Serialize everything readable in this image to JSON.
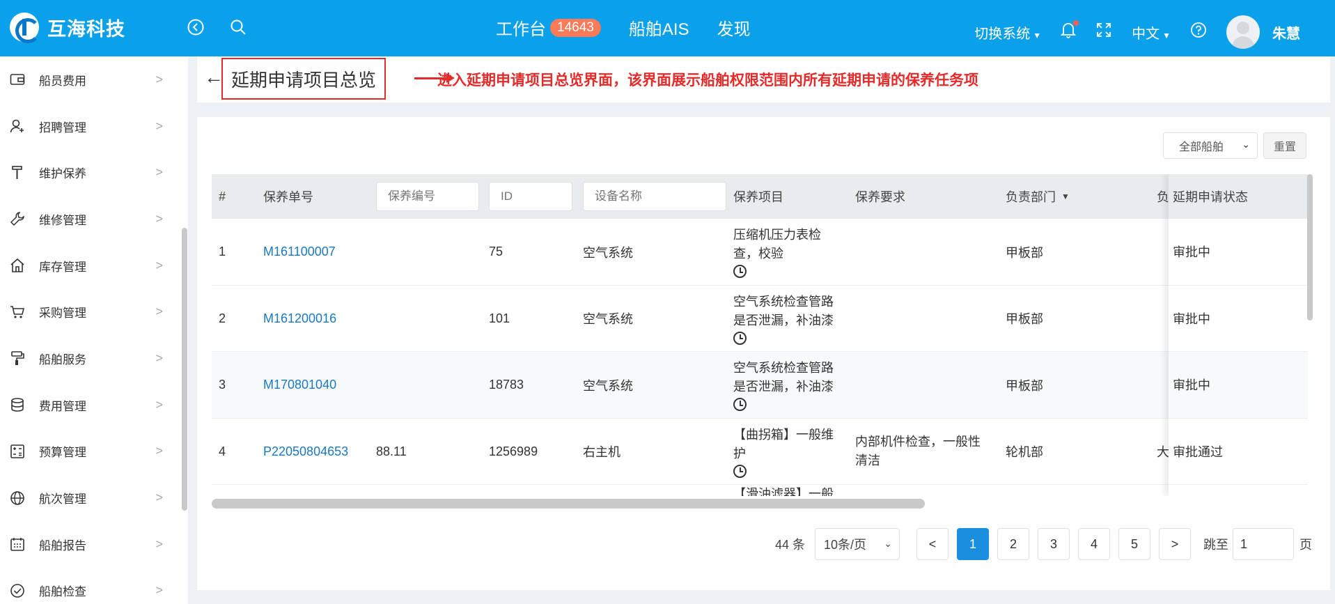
{
  "header": {
    "logo_text": "互海科技",
    "nav": [
      {
        "label": "工作台",
        "badge": "14643"
      },
      {
        "label": "船舶AIS"
      },
      {
        "label": "发现"
      }
    ],
    "switch_system": "切换系统",
    "language": "中文",
    "username": "朱慧"
  },
  "sidebar": {
    "items": [
      {
        "label": "船员费用",
        "icon": "wallet-icon"
      },
      {
        "label": "招聘管理",
        "icon": "user-add-icon"
      },
      {
        "label": "维护保养",
        "icon": "brush-icon"
      },
      {
        "label": "维修管理",
        "icon": "wrench-icon"
      },
      {
        "label": "库存管理",
        "icon": "home-icon"
      },
      {
        "label": "采购管理",
        "icon": "cart-icon"
      },
      {
        "label": "船舶服务",
        "icon": "roller-icon"
      },
      {
        "label": "费用管理",
        "icon": "database-icon"
      },
      {
        "label": "预算管理",
        "icon": "calculator-icon"
      },
      {
        "label": "航次管理",
        "icon": "globe-icon"
      },
      {
        "label": "船舶报告",
        "icon": "calendar-icon"
      },
      {
        "label": "船舶检查",
        "icon": "check-circle-icon"
      }
    ]
  },
  "page": {
    "title": "延期申请项目总览",
    "annotation": "进入延期申请项目总览界面，该界面展示船舶权限范围内所有延期申请的保养任务项"
  },
  "filters": {
    "ship_select": "全部船舶",
    "reset_label": "重置"
  },
  "table": {
    "headers": {
      "index": "#",
      "order_no": "保养单号",
      "item_code_placeholder": "保养编号",
      "id_placeholder": "ID",
      "equipment_placeholder": "设备名称",
      "item": "保养项目",
      "requirement": "保养要求",
      "department": "负责部门",
      "cut_off": "负",
      "status": "延期申请状态"
    },
    "rows": [
      {
        "index": "1",
        "order_no": "M161100007",
        "code": "",
        "id": "75",
        "equipment": "空气系统",
        "item_l1": "压缩机压力表检",
        "item_l2": "查，校验",
        "requirement_l1": "",
        "requirement_l2": "",
        "department": "甲板部",
        "cut": "",
        "status": "审批中"
      },
      {
        "index": "2",
        "order_no": "M161200016",
        "code": "",
        "id": "101",
        "equipment": "空气系统",
        "item_l1": "空气系统检查管路",
        "item_l2": "是否泄漏，补油漆",
        "requirement_l1": "",
        "requirement_l2": "",
        "department": "甲板部",
        "cut": "",
        "status": "审批中"
      },
      {
        "index": "3",
        "order_no": "M170801040",
        "code": "",
        "id": "18783",
        "equipment": "空气系统",
        "item_l1": "空气系统检查管路",
        "item_l2": "是否泄漏，补油漆",
        "requirement_l1": "",
        "requirement_l2": "",
        "department": "甲板部",
        "cut": "",
        "status": "审批中"
      },
      {
        "index": "4",
        "order_no": "P22050804653",
        "code": "88.11",
        "id": "1256989",
        "equipment": "右主机",
        "item_l1": "【曲拐箱】一般维",
        "item_l2": "护",
        "requirement_l1": "内部机件检查，一般性",
        "requirement_l2": "清洁",
        "department": "轮机部",
        "cut": "大",
        "status": "审批通过"
      },
      {
        "index": "",
        "order_no": "",
        "code": "",
        "id": "",
        "equipment": "",
        "item_l1": "【滑油滤器】一般",
        "item_l2": "",
        "requirement_l1": "",
        "requirement_l2": "",
        "department": "",
        "cut": "",
        "status": ""
      }
    ]
  },
  "pagination": {
    "total": "44 条",
    "page_size": "10条/页",
    "prev": "<",
    "next": ">",
    "pages": [
      "1",
      "2",
      "3",
      "4",
      "5"
    ],
    "jump_label": "跳至",
    "jump_value": "1",
    "page_unit": "页"
  },
  "colors": {
    "header_bg": "#0aa0ea",
    "badge_bg": "#ff7a59",
    "annotation_red": "#e52a2a",
    "link_blue": "#1a78c2",
    "active_page": "#1a8fe0"
  }
}
